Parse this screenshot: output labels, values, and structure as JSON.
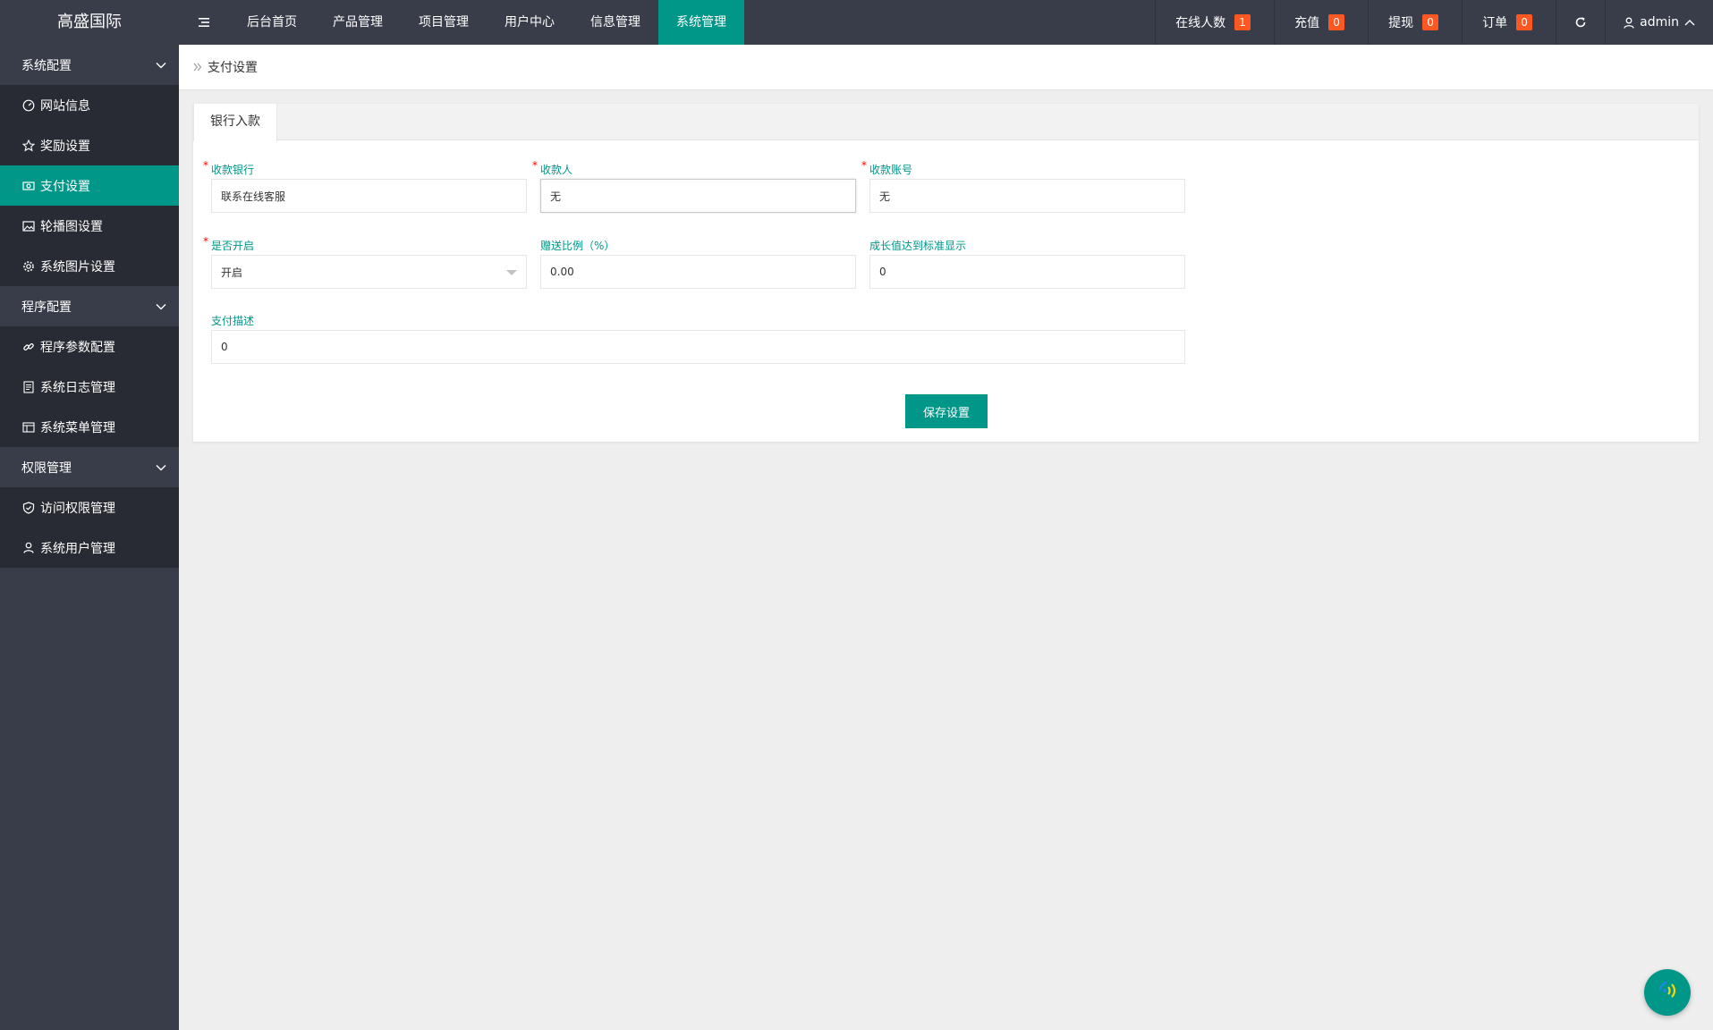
{
  "header": {
    "logo": "高盛国际",
    "nav": [
      {
        "label": "后台首页",
        "active": false
      },
      {
        "label": "产品管理",
        "active": false
      },
      {
        "label": "项目管理",
        "active": false
      },
      {
        "label": "用户中心",
        "active": false
      },
      {
        "label": "信息管理",
        "active": false
      },
      {
        "label": "系统管理",
        "active": true
      }
    ],
    "stats": [
      {
        "label": "在线人数",
        "count": "1"
      },
      {
        "label": "充值",
        "count": "0"
      },
      {
        "label": "提现",
        "count": "0"
      },
      {
        "label": "订单",
        "count": "0"
      }
    ],
    "user": "admin"
  },
  "sidebar": {
    "groups": [
      {
        "label": "系统配置",
        "items": [
          {
            "label": "网站信息",
            "icon": "dashboard-icon"
          },
          {
            "label": "奖励设置",
            "icon": "star-icon"
          },
          {
            "label": "支付设置",
            "icon": "money-icon",
            "active": true
          },
          {
            "label": "轮播图设置",
            "icon": "image-icon"
          },
          {
            "label": "系统图片设置",
            "icon": "gear-icon"
          }
        ]
      },
      {
        "label": "程序配置",
        "items": [
          {
            "label": "程序参数配置",
            "icon": "link-icon"
          },
          {
            "label": "系统日志管理",
            "icon": "log-icon"
          },
          {
            "label": "系统菜单管理",
            "icon": "menu-icon"
          }
        ]
      },
      {
        "label": "权限管理",
        "items": [
          {
            "label": "访问权限管理",
            "icon": "shield-icon"
          },
          {
            "label": "系统用户管理",
            "icon": "user-icon"
          }
        ]
      }
    ]
  },
  "breadcrumb": {
    "current": "支付设置"
  },
  "tabs": [
    {
      "label": "银行入款"
    }
  ],
  "form": {
    "bank": {
      "label": "收款银行",
      "value": "联系在线客服"
    },
    "payee": {
      "label": "收款人",
      "value": "无"
    },
    "account": {
      "label": "收款账号",
      "value": "无"
    },
    "enabled": {
      "label": "是否开启",
      "value": "开启"
    },
    "bonus": {
      "label": "赠送比例（%）",
      "value": "0.00"
    },
    "growth": {
      "label": "成长值达到标准显示",
      "value": "0"
    },
    "desc": {
      "label": "支付描述",
      "value": "0"
    },
    "save": "保存设置"
  },
  "colors": {
    "accent": "#009688",
    "header": "#393d49",
    "badge": "#ff5722",
    "required": "#ff0000"
  }
}
